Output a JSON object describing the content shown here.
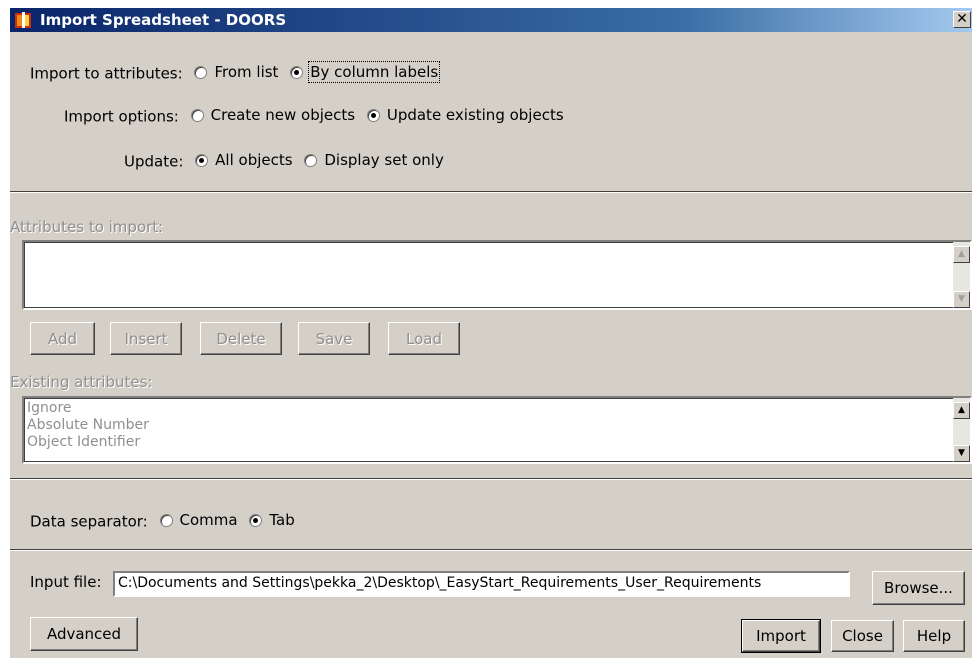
{
  "window": {
    "title": "Import Spreadsheet - DOORS",
    "close_glyph": "✕"
  },
  "import_to_attributes": {
    "label": "Import to attributes:",
    "options": [
      "From list",
      "By column labels"
    ],
    "selected": "By column labels"
  },
  "import_options": {
    "label": "Import options:",
    "options": [
      "Create new objects",
      "Update existing objects"
    ],
    "selected": "Update existing objects"
  },
  "update": {
    "label": "Update:",
    "options": [
      "All objects",
      "Display set only"
    ],
    "selected": "All objects"
  },
  "attributes_to_import": {
    "label": "Attributes to import:",
    "items": []
  },
  "attribute_buttons": {
    "add": "Add",
    "insert": "Insert",
    "delete": "Delete",
    "save": "Save",
    "load": "Load"
  },
  "existing_attributes": {
    "label": "Existing attributes:",
    "items": [
      "Ignore",
      "Absolute Number",
      "Object Identifier"
    ]
  },
  "data_separator": {
    "label": "Data separator:",
    "options": [
      "Comma",
      "Tab"
    ],
    "selected": "Tab"
  },
  "input_file": {
    "label": "Input file:",
    "value": "C:\\Documents and Settings\\pekka_2\\Desktop\\_EasyStart_Requirements_User_Requirements",
    "browse": "Browse..."
  },
  "footer": {
    "advanced": "Advanced",
    "import": "Import",
    "close": "Close",
    "help": "Help"
  },
  "icons": {
    "scroll_up": "▲",
    "scroll_down": "▼"
  },
  "colors": {
    "dialog_bg": "#d4d0c8",
    "title_start": "#0a246a",
    "title_end": "#a6caf0",
    "disabled_text": "#8f8f8f"
  }
}
